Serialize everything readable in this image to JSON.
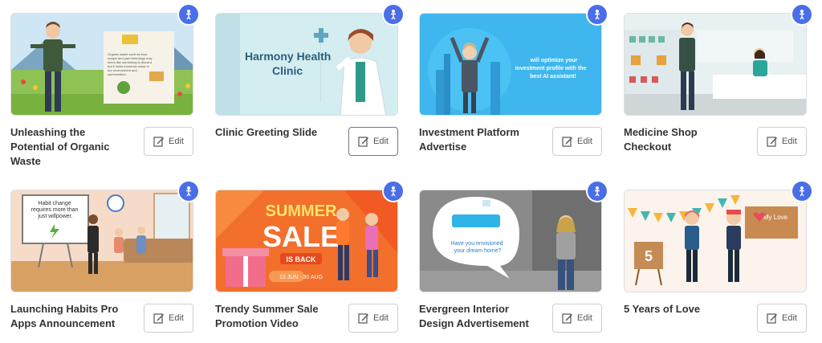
{
  "edit_label": "Edit",
  "cards": [
    {
      "title": "Unleashing the Potential of Organic Waste",
      "slide_text": "Organic waste such as food scraps and yard trimmings may seem like something to discard but it holds immense value to our environment and communities"
    },
    {
      "title": "Clinic Greeting Slide",
      "slide_text": "Harmony Health Clinic"
    },
    {
      "title": "Investment Platform Advertise",
      "slide_text": "will optimize your investment profile with the best AI assistant!"
    },
    {
      "title": "Medicine Shop Checkout"
    },
    {
      "title": "Launching Habits Pro Apps Announcement",
      "slide_text": "Habit change requires more than just willpower."
    },
    {
      "title": "Trendy Summer Sale Promotion Video",
      "slide_text": "SUMMER SALE IS BACK 13 JUN - 30 AUG"
    },
    {
      "title": "Evergreen Interior Design Advertisement",
      "slide_text": "Have you envisioned your dream home?"
    },
    {
      "title": "5 Years of Love",
      "slide_text": "My Love 5"
    }
  ],
  "colors": {
    "badge": "#4a6ee8",
    "title": "#333333",
    "border": "#cfcfcf"
  },
  "icons": {
    "badge": "avatar-figure-icon",
    "edit": "edit-pencil-icon"
  }
}
